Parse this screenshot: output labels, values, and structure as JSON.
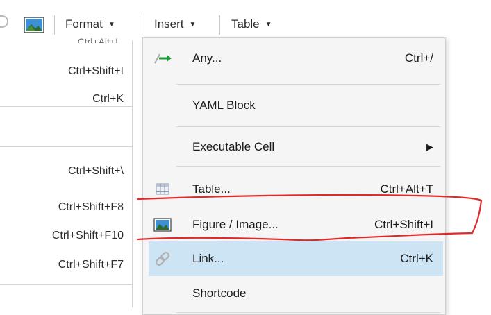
{
  "toolbar": {
    "format_label": "Format",
    "insert_label": "Insert",
    "table_label": "Table"
  },
  "left_panel": {
    "shortcuts": [
      "Ctrl+Shift+I",
      "Ctrl+K",
      "Ctrl+Shift+\\",
      "Ctrl+Shift+F8",
      "Ctrl+Shift+F10",
      "Ctrl+Shift+F7"
    ]
  },
  "insert_menu": {
    "items": [
      {
        "label": "Any...",
        "shortcut": "Ctrl+/",
        "icon": "insert-any-arrow-icon"
      },
      {
        "label": "YAML Block",
        "shortcut": ""
      },
      {
        "label": "Executable Cell",
        "shortcut": "",
        "submenu": true
      },
      {
        "label": "Table...",
        "shortcut": "Ctrl+Alt+T",
        "icon": "table-grid-icon"
      },
      {
        "label": "Figure / Image...",
        "shortcut": "Ctrl+Shift+I",
        "icon": "image-icon"
      },
      {
        "label": "Link...",
        "shortcut": "Ctrl+K",
        "icon": "link-icon",
        "highlighted": true
      },
      {
        "label": "Shortcode",
        "shortcut": ""
      }
    ]
  },
  "colors": {
    "menu_bg": "#f5f5f5",
    "hover_bg": "#cde4f5",
    "annotation": "#e0292b",
    "text": "#1b1b1b"
  }
}
